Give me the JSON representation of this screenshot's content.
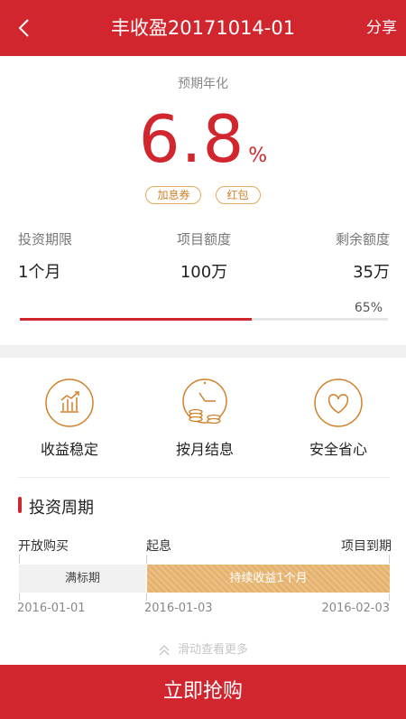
{
  "header": {
    "title": "丰收盈20171014-01",
    "share_label": "分享"
  },
  "rate": {
    "label": "预期年化",
    "value": "6.8",
    "unit": "%"
  },
  "tags": [
    "加息券",
    "红包"
  ],
  "stats": {
    "labels": [
      "投资期限",
      "项目额度",
      "剩余额度"
    ],
    "values": [
      "1个月",
      "100万",
      "35万"
    ]
  },
  "progress": {
    "percent_text": "65%",
    "fraction": 0.63
  },
  "features": [
    {
      "label": "收益稳定",
      "icon": "chart-icon"
    },
    {
      "label": "按月结息",
      "icon": "clock-coins-icon"
    },
    {
      "label": "安全省心",
      "icon": "heart-icon"
    }
  ],
  "section": {
    "title": "投资周期"
  },
  "timeline": {
    "labels": [
      "开放购买",
      "起息",
      "项目到期"
    ],
    "phase1": "满标期",
    "phase2": "持续收益1个月",
    "dates": [
      "2016-01-01",
      "2016-01-03",
      "2016-02-03"
    ]
  },
  "more_hint": "滑动查看更多",
  "buy_button": "立即抢购",
  "colors": {
    "brand": "#d2262f",
    "accent": "#d2802a",
    "timeline_fill": "#e6b36e"
  }
}
